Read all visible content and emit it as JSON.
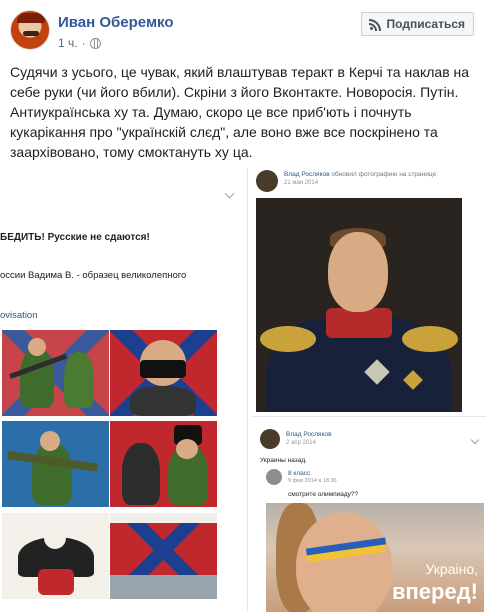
{
  "post": {
    "author": "Иван Оберемко",
    "time": "1 ч.",
    "privacy_icon": "globe-icon",
    "subscribe_label": "Подписаться",
    "subscribe_icon": "rss-icon",
    "text": "Судячи з усього, це чувак, який влаштував теракт в Керчі та наклав на себе руки (чи його вбили). Скріни з його Вконтакте. Новоросія. Путін. Антиукраїнська ху  та. Думаю, скоро це все приб'ють і почнуть кукарікання про \"українскій слєд\", але воно вже все поскрінено та заархівовано, тому смоктануть ху  ца."
  },
  "screens": {
    "left": {
      "line1": "БЕДИТЬ! Русские не сдаются!",
      "line2": "оссии Вадима В. - образец великолепного",
      "line3": "ovisation"
    },
    "right_top": {
      "name": "Влад Росляков",
      "action": "обновил фотографию на странице:",
      "date": "21 мая 2014"
    },
    "right_bottom": {
      "name": "Влад Росляков",
      "date": "2 апр 2014",
      "text": "Украины назад.",
      "repost_name": "8 класс",
      "repost_date": "9 фев 2014 в 18:36",
      "repost_text": "смотрите олимпиаду??",
      "image_line1": "Украіно,",
      "image_line2": "вперед!"
    }
  },
  "colors": {
    "link": "#365899",
    "vk_link": "#2a5885",
    "flag_red": "#c0282d",
    "flag_blue": "#1d3f8f"
  }
}
